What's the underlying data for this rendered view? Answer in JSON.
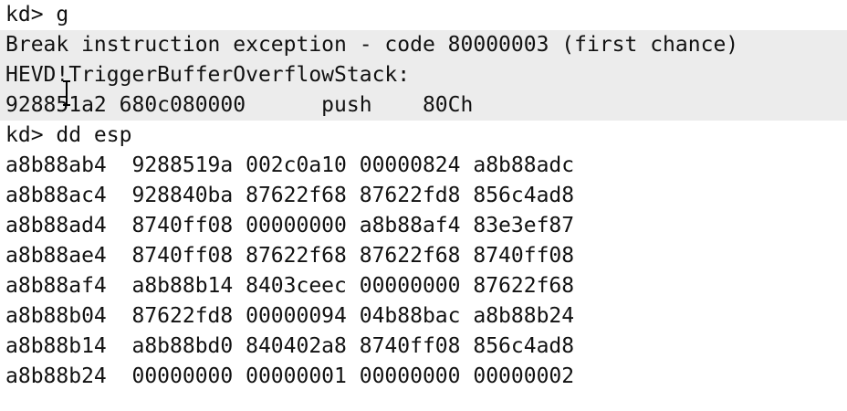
{
  "console": {
    "lines": [
      {
        "text": "kd> g"
      },
      {
        "text": "Break instruction exception - code 80000003 (first chance)"
      },
      {
        "text": "HEVD!TriggerBufferOverflowStack:"
      },
      {
        "text": "928851a2 680c080000      push    80Ch"
      },
      {
        "text": "kd> dd esp"
      },
      {
        "text": "a8b88ab4  9288519a 002c0a10 00000824 a8b88adc"
      },
      {
        "text": "a8b88ac4  928840ba 87622f68 87622fd8 856c4ad8"
      },
      {
        "text": "a8b88ad4  8740ff08 00000000 a8b88af4 83e3ef87"
      },
      {
        "text": "a8b88ae4  8740ff08 87622f68 87622f68 8740ff08"
      },
      {
        "text": "a8b88af4  a8b88b14 8403ceec 00000000 87622f68"
      },
      {
        "text": "a8b88b04  87622fd8 00000094 04b88bac a8b88b24"
      },
      {
        "text": "a8b88b14  a8b88bd0 840402a8 8740ff08 856c4ad8"
      },
      {
        "text": "a8b88b24  00000000 00000001 00000000 00000002"
      }
    ]
  },
  "colors": {
    "background": "#ffffff",
    "highlight": "#ececec",
    "text": "#111111"
  }
}
